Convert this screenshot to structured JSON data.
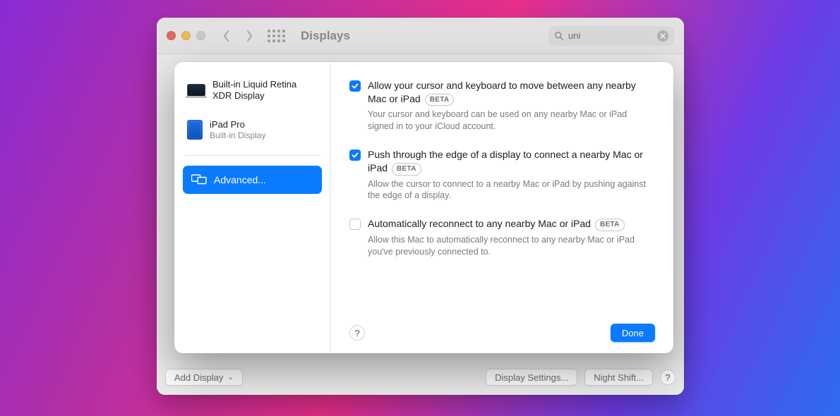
{
  "window": {
    "title": "Displays"
  },
  "search": {
    "value": "uni"
  },
  "bottom": {
    "add_display": "Add Display",
    "display_settings": "Display Settings...",
    "night_shift": "Night Shift..."
  },
  "sheet": {
    "devices": [
      {
        "name": "Built-in Liquid Retina XDR Display",
        "sub": ""
      },
      {
        "name": "iPad Pro",
        "sub": "Built-in Display"
      }
    ],
    "advanced_label": "Advanced...",
    "options": [
      {
        "checked": true,
        "label": "Allow your cursor and keyboard to move between any nearby Mac or iPad",
        "badge": "BETA",
        "desc": "Your cursor and keyboard can be used on any nearby Mac or iPad signed in to your iCloud account."
      },
      {
        "checked": true,
        "label": "Push through the edge of a display to connect a nearby Mac or iPad",
        "badge": "BETA",
        "desc": "Allow the cursor to connect to a nearby Mac or iPad by pushing against the edge of a display."
      },
      {
        "checked": false,
        "label": "Automatically reconnect to any nearby Mac or iPad",
        "badge": "BETA",
        "desc": "Allow this Mac to automatically reconnect to any nearby Mac or iPad you've previously connected to."
      }
    ],
    "done": "Done"
  }
}
